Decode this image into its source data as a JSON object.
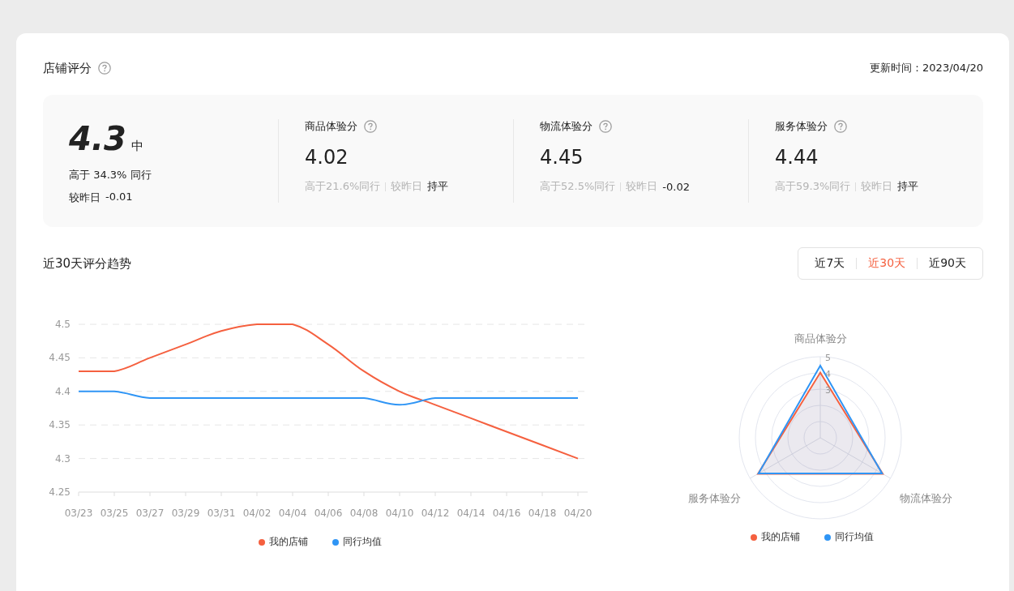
{
  "header": {
    "title": "店铺评分",
    "update_time": "更新时间：2023/04/20"
  },
  "summary": {
    "score": "4.3",
    "grade": "中",
    "above_text": "高于 34.3% 同行",
    "compare_label": "较昨日",
    "compare_value": "-0.01"
  },
  "metrics": [
    {
      "label": "商品体验分",
      "value": "4.02",
      "above": "高于21.6%同行",
      "compare_label": "较昨日",
      "compare_value": "持平"
    },
    {
      "label": "物流体验分",
      "value": "4.45",
      "above": "高于52.5%同行",
      "compare_label": "较昨日",
      "compare_value": "-0.02"
    },
    {
      "label": "服务体验分",
      "value": "4.44",
      "above": "高于59.3%同行",
      "compare_label": "较昨日",
      "compare_value": "持平"
    }
  ],
  "trend": {
    "title": "近30天评分趋势",
    "tabs": [
      {
        "label": "近7天",
        "selected": false
      },
      {
        "label": "近30天",
        "selected": true
      },
      {
        "label": "近90天",
        "selected": false
      }
    ],
    "chart_data": {
      "type": "line",
      "categories": [
        "03/23",
        "03/25",
        "03/27",
        "03/29",
        "03/31",
        "04/02",
        "04/04",
        "04/06",
        "04/08",
        "04/10",
        "04/12",
        "04/14",
        "04/16",
        "04/18",
        "04/20"
      ],
      "series": [
        {
          "name": "我的店铺",
          "color": "#f5603f",
          "values": [
            4.43,
            4.43,
            4.45,
            4.47,
            4.49,
            4.5,
            4.5,
            4.47,
            4.43,
            4.4,
            4.38,
            4.36,
            4.34,
            4.32,
            4.3
          ]
        },
        {
          "name": "同行均值",
          "color": "#2f95f5",
          "values": [
            4.4,
            4.4,
            4.39,
            4.39,
            4.39,
            4.39,
            4.39,
            4.39,
            4.39,
            4.38,
            4.39,
            4.39,
            4.39,
            4.39,
            4.39
          ]
        }
      ],
      "grid": true,
      "legend": true,
      "ylim": [
        4.25,
        4.5
      ],
      "yticks": [
        {
          "value": 4.25,
          "label": "4.25"
        },
        {
          "value": 4.3,
          "label": "4.3"
        },
        {
          "value": 4.35,
          "label": "4.35"
        },
        {
          "value": 4.4,
          "label": "4.4"
        },
        {
          "value": 4.45,
          "label": "4.45"
        },
        {
          "value": 4.5,
          "label": "4.5"
        }
      ]
    }
  },
  "radar": {
    "axes": [
      "商品体验分",
      "物流体验分",
      "服务体验分"
    ],
    "ticks": [
      "5",
      "4",
      "3"
    ],
    "legend": [
      {
        "name": "我的店铺",
        "color": "#f5603f"
      },
      {
        "name": "同行均值",
        "color": "#2f95f5"
      }
    ]
  }
}
